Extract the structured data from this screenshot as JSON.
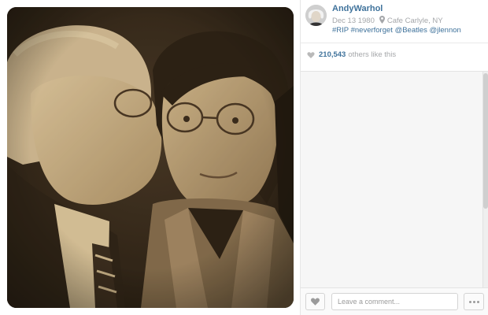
{
  "post": {
    "username": "AndyWarhol",
    "date": "Dec 13 1980",
    "location": "Cafe Carlyle, NY",
    "caption": "#RIP #neverforget @Beatles @jlennon"
  },
  "likes": {
    "count": "210,543",
    "text": "others like this"
  },
  "comment_box": {
    "placeholder": "Leave a comment..."
  },
  "icons": {
    "location": "location-pin-icon",
    "likes": "heart-icon",
    "like_button": "heart-icon",
    "more": "ellipsis-icon"
  },
  "colors": {
    "link": "#3f729b",
    "muted": "#a5a7aa",
    "photo_tone": "#c9b08a"
  }
}
